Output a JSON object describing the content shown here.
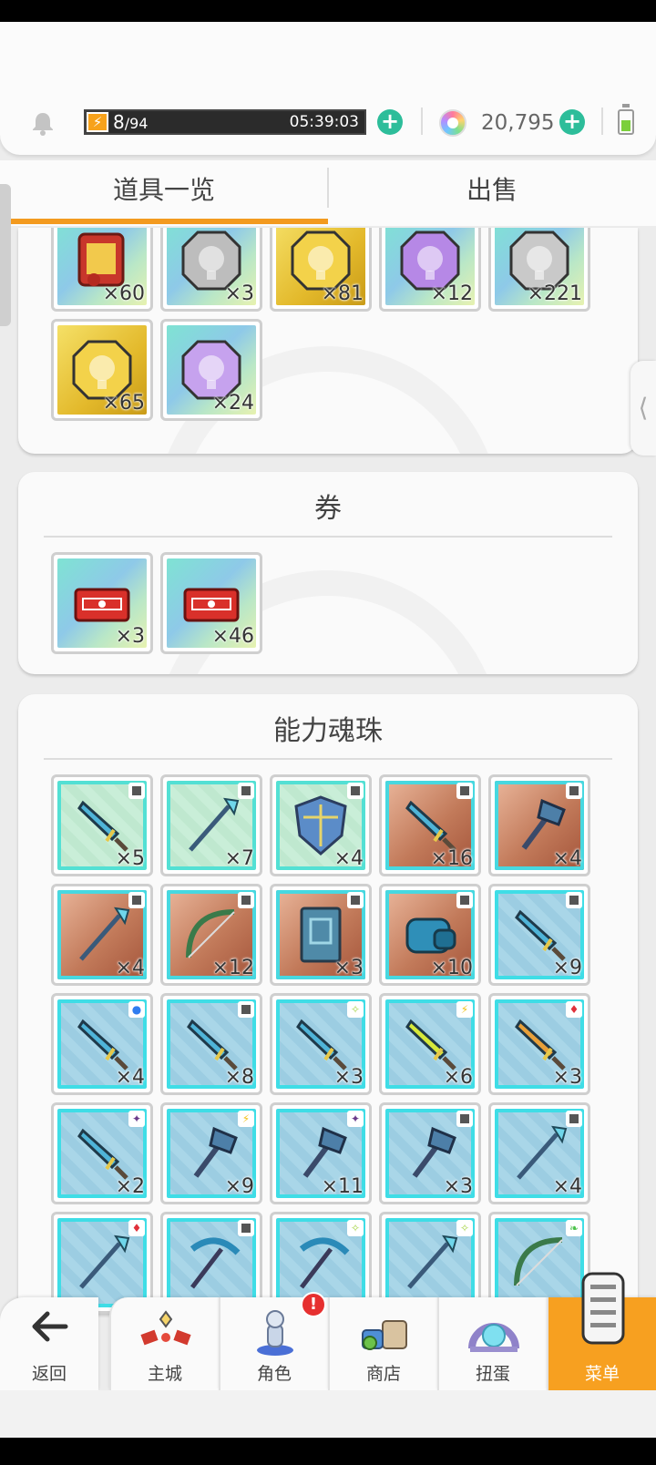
{
  "header": {
    "stamina_current": "8",
    "stamina_max": "/94",
    "stamina_fraction": 0.085,
    "stamina_timer": "05:39:03",
    "gem_count": "20,795"
  },
  "tabs": [
    {
      "label": "道具一览",
      "active": true
    },
    {
      "label": "出售",
      "active": false
    }
  ],
  "panels": {
    "materials": {
      "items": [
        {
          "count": "×60",
          "bg": "rainbow",
          "icon": "scroll-icon"
        },
        {
          "count": "×3",
          "bg": "rainbow",
          "icon": "silver-medal-icon"
        },
        {
          "count": "×81",
          "bg": "gold",
          "icon": "gold-medal-icon"
        },
        {
          "count": "×12",
          "bg": "rainbow",
          "icon": "purple-medal-icon"
        },
        {
          "count": "×221",
          "bg": "rainbow",
          "icon": "silver-paw-medal-icon"
        },
        {
          "count": "×65",
          "bg": "gold",
          "icon": "gold-paw-medal-icon"
        },
        {
          "count": "×24",
          "bg": "rainbow",
          "icon": "purple-paw-medal-icon"
        }
      ]
    },
    "tickets": {
      "title": "券",
      "items": [
        {
          "count": "×3",
          "bg": "rainbow",
          "icon": "red-ticket-stack-icon"
        },
        {
          "count": "×46",
          "bg": "rainbow",
          "icon": "red-ticket-icon"
        }
      ]
    },
    "orbs": {
      "title": "能力魂珠",
      "items": [
        {
          "count": "×5",
          "bg": "green",
          "icon": "dagger-icon",
          "rank": "square"
        },
        {
          "count": "×7",
          "bg": "green",
          "icon": "staff-icon",
          "rank": "square"
        },
        {
          "count": "×4",
          "bg": "green",
          "icon": "shield-icon",
          "rank": "square"
        },
        {
          "count": "×16",
          "bg": "orange",
          "icon": "sword-icon",
          "rank": "square"
        },
        {
          "count": "×4",
          "bg": "orange",
          "icon": "axe-icon",
          "rank": "square"
        },
        {
          "count": "×4",
          "bg": "orange",
          "icon": "spear-icon",
          "rank": "square"
        },
        {
          "count": "×12",
          "bg": "orange",
          "icon": "bow-icon",
          "rank": "square"
        },
        {
          "count": "×3",
          "bg": "orange",
          "icon": "tome-icon",
          "rank": "square"
        },
        {
          "count": "×10",
          "bg": "orange",
          "icon": "gauntlet-icon",
          "rank": "square"
        },
        {
          "count": "×9",
          "bg": "blue",
          "icon": "sword-icon",
          "rank": "square"
        },
        {
          "count": "×4",
          "bg": "blue",
          "icon": "knife-icon",
          "rank": "water"
        },
        {
          "count": "×8",
          "bg": "blue",
          "icon": "scimitar-icon",
          "rank": "square"
        },
        {
          "count": "×3",
          "bg": "blue",
          "icon": "dagger-icon",
          "rank": "light"
        },
        {
          "count": "×6",
          "bg": "blue",
          "icon": "lightning-sword-icon",
          "rank": "thunder"
        },
        {
          "count": "×3",
          "bg": "blue",
          "icon": "flame-sword-icon",
          "rank": "fire"
        },
        {
          "count": "×2",
          "bg": "blue",
          "icon": "knife-icon",
          "rank": "dark"
        },
        {
          "count": "×9",
          "bg": "blue",
          "icon": "pickaxe-icon",
          "rank": "thunder"
        },
        {
          "count": "×11",
          "bg": "blue",
          "icon": "axe-icon",
          "rank": "dark"
        },
        {
          "count": "×3",
          "bg": "blue",
          "icon": "hammer-icon",
          "rank": "square"
        },
        {
          "count": "×4",
          "bg": "blue",
          "icon": "spear-icon",
          "rank": "square"
        },
        {
          "count": "",
          "bg": "blue",
          "icon": "spear-icon",
          "rank": "fire"
        },
        {
          "count": "",
          "bg": "blue",
          "icon": "scythe-icon",
          "rank": "square"
        },
        {
          "count": "",
          "bg": "blue",
          "icon": "scythe-icon",
          "rank": "light"
        },
        {
          "count": "",
          "bg": "blue",
          "icon": "lance-icon",
          "rank": "light"
        },
        {
          "count": "",
          "bg": "blue",
          "icon": "bow-icon",
          "rank": "wind"
        }
      ]
    }
  },
  "bottom_nav": [
    {
      "label": "返回",
      "icon": "back-arrow-icon"
    },
    {
      "label": "主城",
      "icon": "castle-icon"
    },
    {
      "label": "角色",
      "icon": "character-icon",
      "alert": "!"
    },
    {
      "label": "商店",
      "icon": "shop-icon"
    },
    {
      "label": "扭蛋",
      "icon": "gacha-icon"
    },
    {
      "label": "菜单",
      "icon": "menu-icon",
      "active": true
    }
  ],
  "colors": {
    "accent": "#f39a1f",
    "plus": "#2dbd9a",
    "alert": "#e63030"
  }
}
